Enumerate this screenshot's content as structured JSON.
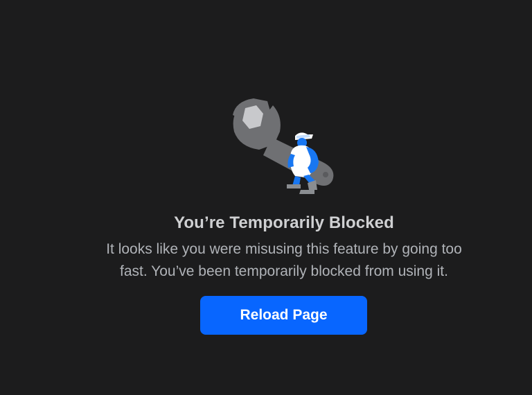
{
  "illustration": {
    "icon": "wrench-worker-icon",
    "colors": {
      "wrench": "#6f7073",
      "nut": "#c8c9cc",
      "figure_blue": "#1877f2",
      "figure_white": "#ffffff",
      "figure_gray": "#8a8d91"
    }
  },
  "block": {
    "title": "You’re Temporarily Blocked",
    "message_line1": "It looks like you were misusing this feature by going too",
    "message_line2": "fast. You’ve been temporarily blocked from using it."
  },
  "actions": {
    "reload_label": "Reload Page",
    "reload_color": "#0866ff"
  }
}
